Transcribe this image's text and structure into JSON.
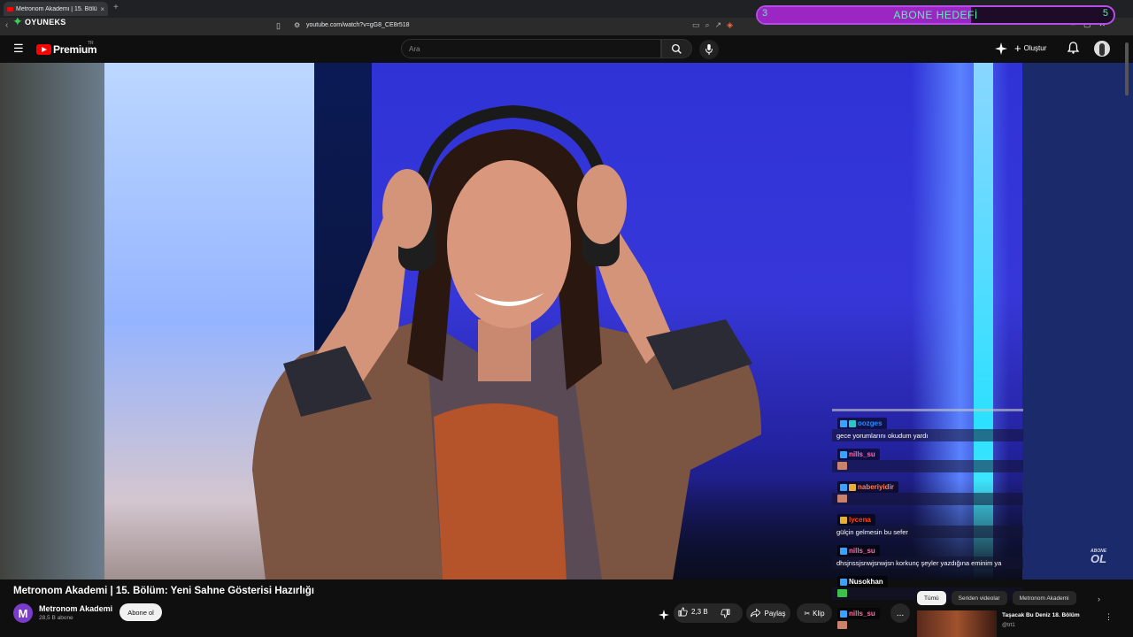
{
  "browser": {
    "tab_title": "Metronom Akademi | 15. Bölüm...",
    "new_tab": "+",
    "url": "youtube.com/watch?v=gG8_CE8r518"
  },
  "overlay": {
    "brand": "OYUNEKS",
    "sub_goal": {
      "label": "ABONE HEDEFİ",
      "current": "3",
      "target": "5",
      "progress": 0.6,
      "color": "#9b26c4",
      "text_color": "#5df0b0"
    },
    "watermark_top": "ABONE",
    "watermark_bottom": "OL"
  },
  "youtube": {
    "logo_text": "Premium",
    "region": "TR",
    "search_placeholder": "Ara",
    "create_label": "Oluştur",
    "brand_color": "#ff0000"
  },
  "video": {
    "title": "Metronom Akademi | 15. Bölüm: Yeni Sahne Gösterisi Hazırlığı",
    "channel": {
      "name": "Metronom Akademi",
      "initial": "M",
      "subscribers": "28,5 B abone"
    },
    "subscribe_label": "Abone ol",
    "likes": "2,3 B",
    "share_label": "Paylaş",
    "clip_label": "Klip",
    "more_label": "..."
  },
  "chat": {
    "messages": [
      {
        "user": "oozges",
        "color": "#1e90ff",
        "text": "gece yorumlarını okudum yardı"
      },
      {
        "user": "nills_su",
        "color": "#ff6ea8",
        "text": ""
      },
      {
        "user": "naberiyidir",
        "color": "#ff7f50",
        "text": ""
      },
      {
        "user": "lycena",
        "color": "#ff4500",
        "text": "gülçin gelmesin bu sefer"
      },
      {
        "user": "nills_su",
        "color": "#ff6ea8",
        "text": "dhsjnssjsnwjsnwjsn korkunç şeyler yazdığına eminim ya"
      },
      {
        "user": "Nusokhan",
        "color": "#ffffff",
        "text": ""
      },
      {
        "user": "nills_su",
        "color": "#ff6ea8",
        "text": ""
      }
    ]
  },
  "recommendations": {
    "chips": [
      "Tümü",
      "Seriden videolar",
      "Metronom Akademi"
    ],
    "active_chip": "Tümü",
    "item": {
      "title": "Taşacak Bu Deniz 18. Bölüm",
      "channel": "@trt1"
    }
  }
}
